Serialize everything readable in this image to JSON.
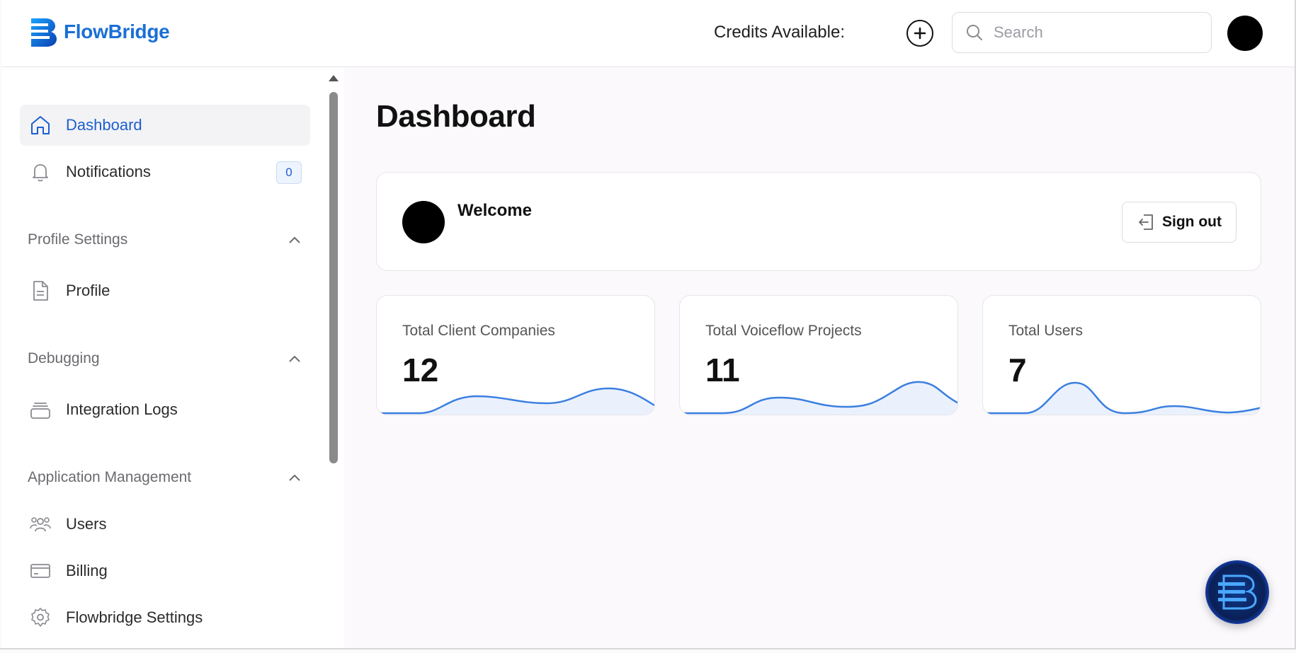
{
  "header": {
    "brand": "FlowBridge",
    "credits_label": "Credits Available:",
    "search_placeholder": "Search"
  },
  "sidebar": {
    "top_items": [
      {
        "label": "Dashboard",
        "icon": "home-icon",
        "active": true
      },
      {
        "label": "Notifications",
        "icon": "bell-icon",
        "badge": "0"
      }
    ],
    "sections": [
      {
        "title": "Profile Settings",
        "items": [
          {
            "label": "Profile",
            "icon": "document-icon"
          }
        ]
      },
      {
        "title": "Debugging",
        "items": [
          {
            "label": "Integration Logs",
            "icon": "archive-icon"
          }
        ]
      },
      {
        "title": "Application Management",
        "items": [
          {
            "label": "Users",
            "icon": "users-icon"
          },
          {
            "label": "Billing",
            "icon": "credit-card-icon"
          },
          {
            "label": "Flowbridge Settings",
            "icon": "gear-icon"
          }
        ]
      }
    ]
  },
  "main": {
    "title": "Dashboard",
    "welcome": "Welcome",
    "signout_label": "Sign out",
    "stats": [
      {
        "label": "Total Client Companies",
        "value": "12"
      },
      {
        "label": "Total Voiceflow Projects",
        "value": "11"
      },
      {
        "label": "Total Users",
        "value": "7"
      }
    ]
  },
  "colors": {
    "accent": "#1c5fd1",
    "brand": "#1a6fd6",
    "spark_line": "#3b7fe0",
    "spark_fill": "#eaf1fd"
  }
}
